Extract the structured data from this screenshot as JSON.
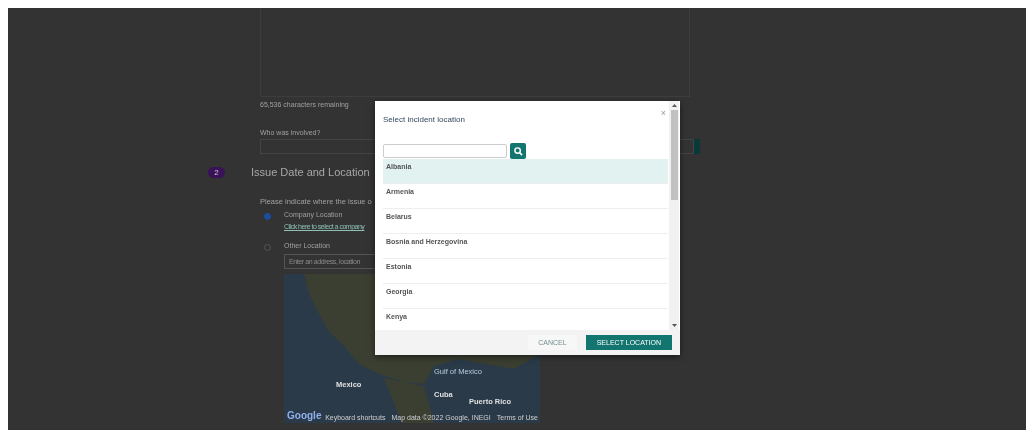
{
  "form": {
    "characters_remaining": "65,536 characters remaining",
    "involved_label": "Who was involved?",
    "step_number": "2",
    "section_title": "Issue Date and Location",
    "prompt": "Please indicate where the issue o",
    "location_options": [
      {
        "label": "Company Location",
        "selected": true,
        "link": "Click here to select a company"
      },
      {
        "label": "Other Location",
        "selected": false,
        "placeholder": "Enter an address, location"
      }
    ],
    "map": {
      "labels": [
        {
          "text": "Mexico",
          "kind": "country"
        },
        {
          "text": "Gulf of Mexico",
          "kind": "water"
        },
        {
          "text": "Cuba",
          "kind": "country"
        },
        {
          "text": "Puerto Rico",
          "kind": "country"
        }
      ],
      "logo": "Google",
      "footer": [
        "Keyboard shortcuts",
        "Map data ©2022 Google, INEGI",
        "Terms of Use"
      ]
    }
  },
  "modal": {
    "title": "Select incident location",
    "close": "×",
    "items": [
      {
        "label": "Albania",
        "selected": true
      },
      {
        "label": "Armenia",
        "selected": false
      },
      {
        "label": "Belarus",
        "selected": false
      },
      {
        "label": "Bosnia and Herzegovina",
        "selected": false
      },
      {
        "label": "Estonia",
        "selected": false
      },
      {
        "label": "Georgia",
        "selected": false
      },
      {
        "label": "Kenya",
        "selected": false
      }
    ],
    "cancel": "CANCEL",
    "confirm": "SELECT LOCATION"
  }
}
